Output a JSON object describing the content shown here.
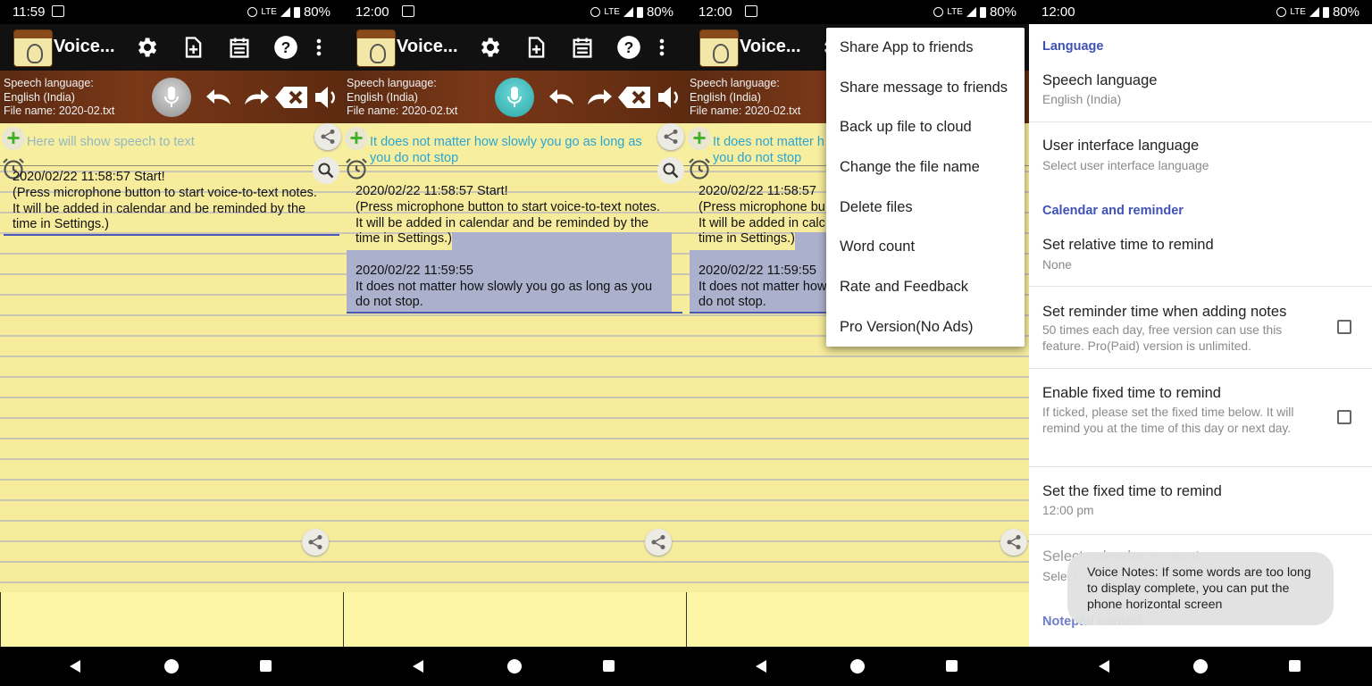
{
  "status": [
    {
      "time": "11:59",
      "net": "LTE",
      "battery": "80%"
    },
    {
      "time": "12:00",
      "net": "LTE",
      "battery": "80%"
    },
    {
      "time": "12:00",
      "net": "LTE",
      "battery": "80%"
    },
    {
      "time": "12:00",
      "net": "LTE",
      "battery": "80%"
    }
  ],
  "app": {
    "title": "Voice...",
    "speech_language_label": "Speech language:",
    "speech_language_value": "English (India)",
    "file_name": "File name: 2020-02.txt"
  },
  "screen1": {
    "speech_placeholder": "Here will show speech to text",
    "note": "2020/02/22 11:58:57 Start!\n(Press microphone button to start voice-to-text notes.\nIt will be added in calendar and be reminded by the\ntime in Settings.)"
  },
  "screen2": {
    "speech_line1": "It does not matter how slowly you go as long as",
    "speech_line2": "you do not stop",
    "note_block1": "2020/02/22 11:58:57 Start!\n(Press microphone button to start voice-to-text notes.\nIt will be added in calendar and be reminded by the\ntime in Settings.)",
    "note_block2": "\n2020/02/22 11:59:55\nIt does not matter how slowly you go as long as you\ndo not stop."
  },
  "screen3": {
    "speech_line1": "It does not matter h",
    "speech_line2": "you do not stop",
    "note_block1": "2020/02/22 11:58:57\n(Press microphone bu\nIt will be added in calc\ntime in Settings.)",
    "note_block2": "\n2020/02/22 11:59:55\nIt does not matter how\ndo not stop."
  },
  "menu": {
    "items": [
      "Share App to friends",
      "Share message to friends",
      "Back up file to cloud",
      "Change the file name",
      "Delete files",
      "Word count",
      "Rate and Feedback",
      "Pro Version(No Ads)"
    ]
  },
  "settings": {
    "cat_language": "Language",
    "speech_language_title": "Speech language",
    "speech_language_value": "English (India)",
    "ui_language_title": "User interface language",
    "ui_language_sub": "Select user interface language",
    "cat_calendar": "Calendar and reminder",
    "relative_title": "Set relative time to remind",
    "relative_value": "None",
    "reminder_adding_title": "Set reminder time when adding notes",
    "reminder_adding_sub": "50 times each day, free version can use this feature. Pro(Paid) version is unlimited.",
    "fixed_enable_title": "Enable fixed time to remind",
    "fixed_enable_sub": "If ticked, please set the fixed time below. It will remind you at the time of this day or next day.",
    "fixed_time_title": "Set the fixed time to remind",
    "fixed_time_value": "12:00 pm",
    "calendar_account_title": "Select calendar account",
    "calendar_account_sub": "Select",
    "cat_notepad": "Notepad control",
    "toast": "Voice Notes: If some words are too long to display complete, you can put the phone horizontal screen"
  }
}
